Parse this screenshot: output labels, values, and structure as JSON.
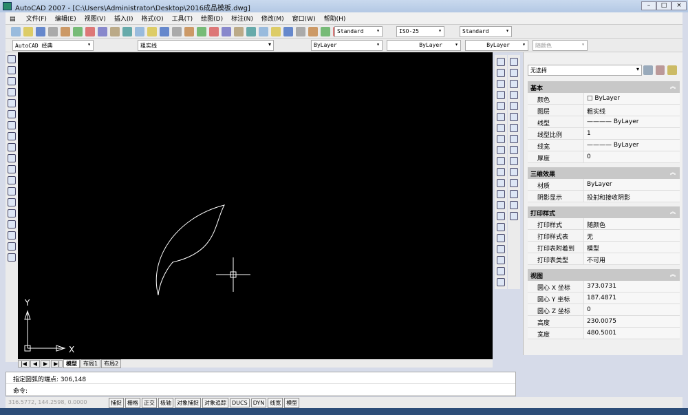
{
  "window": {
    "title": "AutoCAD 2007 - [C:\\Users\\Administrator\\Desktop\\2016成品模板.dwg]",
    "min": "–",
    "max": "□",
    "close": "×"
  },
  "menu": [
    "文件(F)",
    "编辑(E)",
    "视图(V)",
    "插入(I)",
    "格式(O)",
    "工具(T)",
    "绘图(D)",
    "标注(N)",
    "修改(M)",
    "窗口(W)",
    "帮助(H)"
  ],
  "toolbar": {
    "text_style": "Standard",
    "dim_style": "ISO-25",
    "table_style": "Standard",
    "workspace": "AutoCAD 经典",
    "layer": "粗实线",
    "color": "ByLayer",
    "linetype": "ByLayer",
    "lineweight": "ByLayer",
    "plotstyle": "随颜色"
  },
  "properties": {
    "selection": "无选择",
    "sections": [
      {
        "title": "基本",
        "rows": [
          [
            "颜色",
            "□ ByLayer"
          ],
          [
            "图层",
            "粗实线"
          ],
          [
            "线型",
            "———— ByLayer"
          ],
          [
            "线型比例",
            "1"
          ],
          [
            "线宽",
            "———— ByLayer"
          ],
          [
            "厚度",
            "0"
          ]
        ]
      },
      {
        "title": "三维效果",
        "rows": [
          [
            "材质",
            "ByLayer"
          ],
          [
            "阴影显示",
            "投射和接收阴影"
          ]
        ]
      },
      {
        "title": "打印样式",
        "rows": [
          [
            "打印样式",
            "随颜色"
          ],
          [
            "打印样式表",
            "无"
          ],
          [
            "打印表附着到",
            "模型"
          ],
          [
            "打印表类型",
            "不可用"
          ]
        ]
      },
      {
        "title": "视图",
        "rows": [
          [
            "圆心 X 坐标",
            "373.0731"
          ],
          [
            "圆心 Y 坐标",
            "187.4871"
          ],
          [
            "圆心 Z 坐标",
            "0"
          ],
          [
            "高度",
            "230.0075"
          ],
          [
            "宽度",
            "480.5001"
          ]
        ]
      }
    ]
  },
  "ucs": {
    "x": "X",
    "y": "Y"
  },
  "tabs": [
    "|◀",
    "◀",
    "▶",
    "▶|",
    "模型",
    "布局1",
    "布局2"
  ],
  "command": {
    "history": "指定圆弧的端点: 306,148",
    "prompt": "命令:"
  },
  "status": {
    "coords": "316.5772, 144.2598, 0.0000",
    "buttons": [
      "捕捉",
      "栅格",
      "正交",
      "极轴",
      "对象捕捉",
      "对象追踪",
      "DUCS",
      "DYN",
      "线宽",
      "模型"
    ]
  }
}
